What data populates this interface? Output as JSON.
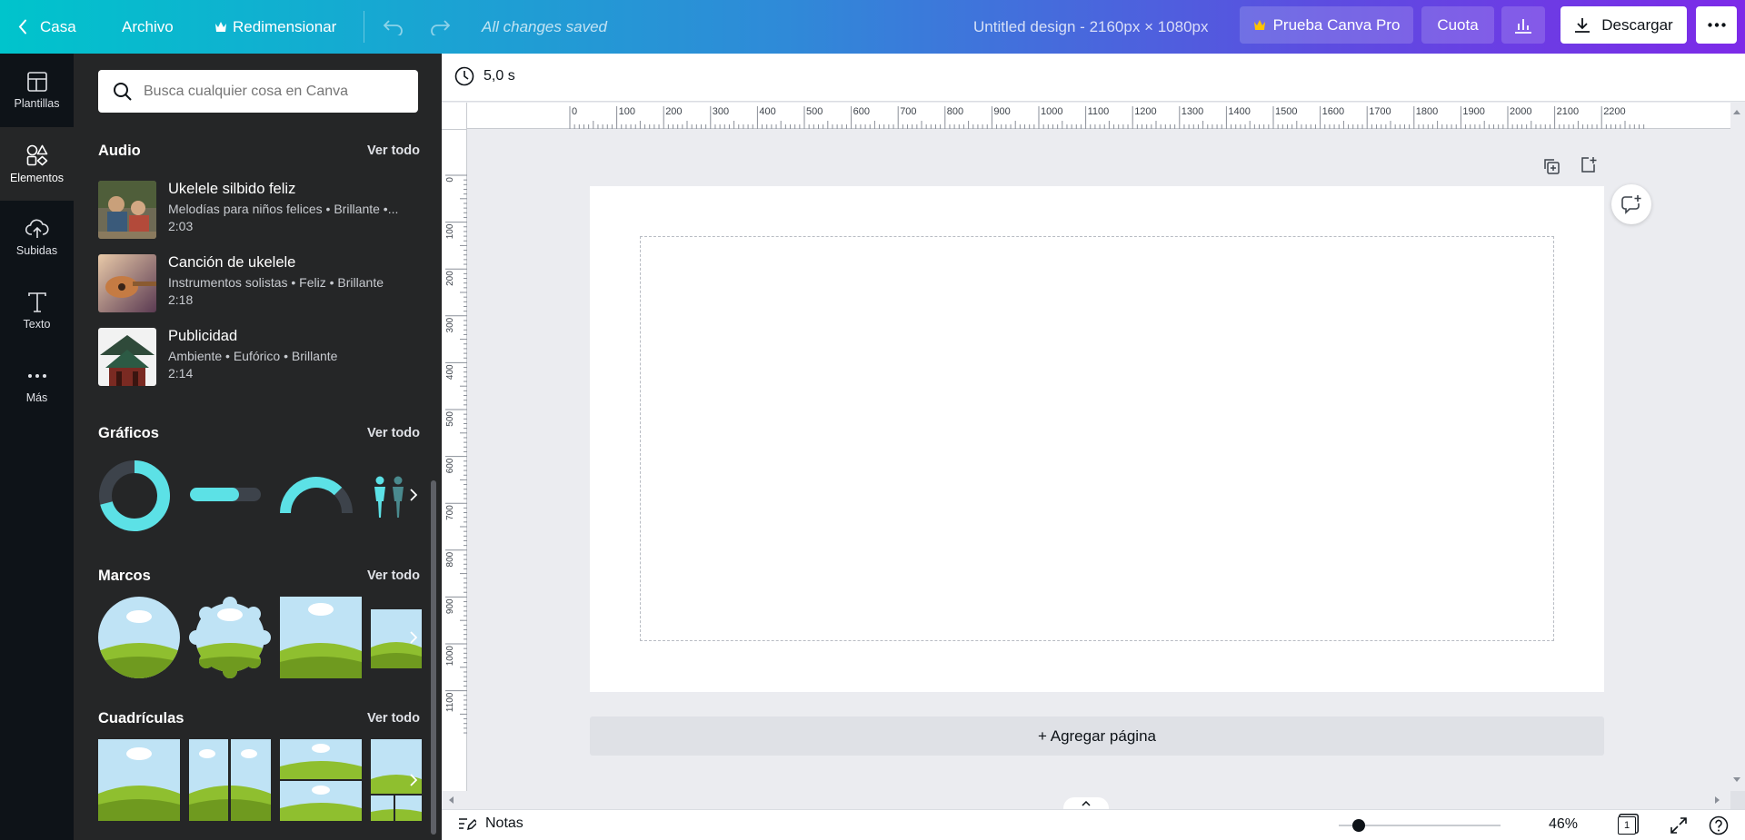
{
  "topbar": {
    "home_label": "Casa",
    "file_label": "Archivo",
    "resize_label": "Redimensionar",
    "saved_status": "All changes saved",
    "design_title": "Untitled design - 2160px × 1080px",
    "pro_label": "Prueba Canva Pro",
    "quota_label": "Cuota",
    "download_label": "Descargar"
  },
  "rail": {
    "items": [
      {
        "label": "Plantillas",
        "icon": "templates-icon"
      },
      {
        "label": "Elementos",
        "icon": "elements-icon"
      },
      {
        "label": "Subidas",
        "icon": "upload-cloud-icon"
      },
      {
        "label": "Texto",
        "icon": "text-icon"
      },
      {
        "label": "Más",
        "icon": "more-dots-icon"
      }
    ]
  },
  "panel": {
    "search_placeholder": "Busca cualquier cosa en Canva",
    "see_all": "Ver todo",
    "audio": {
      "title": "Audio",
      "tracks": [
        {
          "title": "Ukelele silbido feliz",
          "tags": "Melodías para niños felices • Brillante •...",
          "duration": "2:03"
        },
        {
          "title": "Canción de ukelele",
          "tags": "Instrumentos solistas • Feliz • Brillante",
          "duration": "2:18"
        },
        {
          "title": "Publicidad",
          "tags": "Ambiente • Eufórico • Brillante",
          "duration": "2:14"
        }
      ]
    },
    "graphics": {
      "title": "Gráficos"
    },
    "frames": {
      "title": "Marcos"
    },
    "grids": {
      "title": "Cuadrículas"
    }
  },
  "editor": {
    "duration": "5,0 s",
    "ruler_h": [
      "0",
      "100",
      "200",
      "300",
      "400",
      "500",
      "600",
      "700",
      "800",
      "900",
      "1000",
      "1100",
      "1200",
      "1300",
      "1400",
      "1500",
      "1600",
      "1700",
      "1800",
      "1900",
      "2000",
      "2100",
      "2200"
    ],
    "ruler_v": [
      "0",
      "100",
      "200",
      "300",
      "400",
      "500",
      "600",
      "700",
      "800",
      "900",
      "1000",
      "1100"
    ],
    "add_page": "+ Agregar página",
    "notes": "Notas",
    "zoom": "46%",
    "zoom_fraction": 0.46,
    "page_count": "1"
  },
  "colors": {
    "accent_teal": "#00c4cc",
    "accent_purple": "#7d2ae8",
    "panel_bg": "#252627",
    "rail_bg": "#0e1318",
    "graphic_teal": "#5ce1e6",
    "graphic_dark": "#3d434b"
  }
}
